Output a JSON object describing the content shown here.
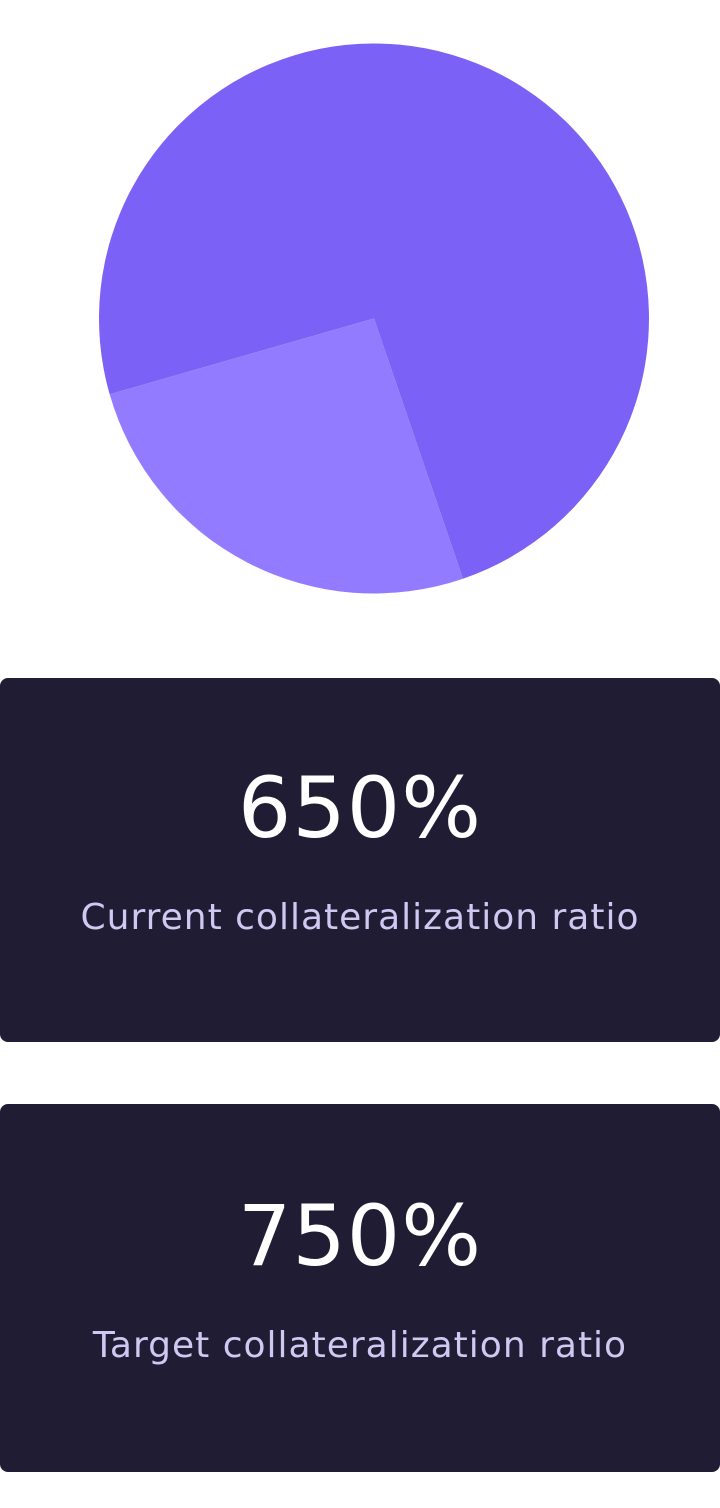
{
  "chart_data": {
    "type": "pie",
    "slices": [
      {
        "value": 0.742,
        "color": "#7b61f5"
      },
      {
        "value": 0.258,
        "color": "#937bff"
      }
    ]
  },
  "stats": [
    {
      "value": "650%",
      "label": "Current collateralization ratio"
    },
    {
      "value": "750%",
      "label": "Target collateralization ratio"
    }
  ],
  "theme": {
    "card_background": "#1f1c33",
    "value_color": "#ffffff",
    "label_color": "#cfc9f2"
  }
}
